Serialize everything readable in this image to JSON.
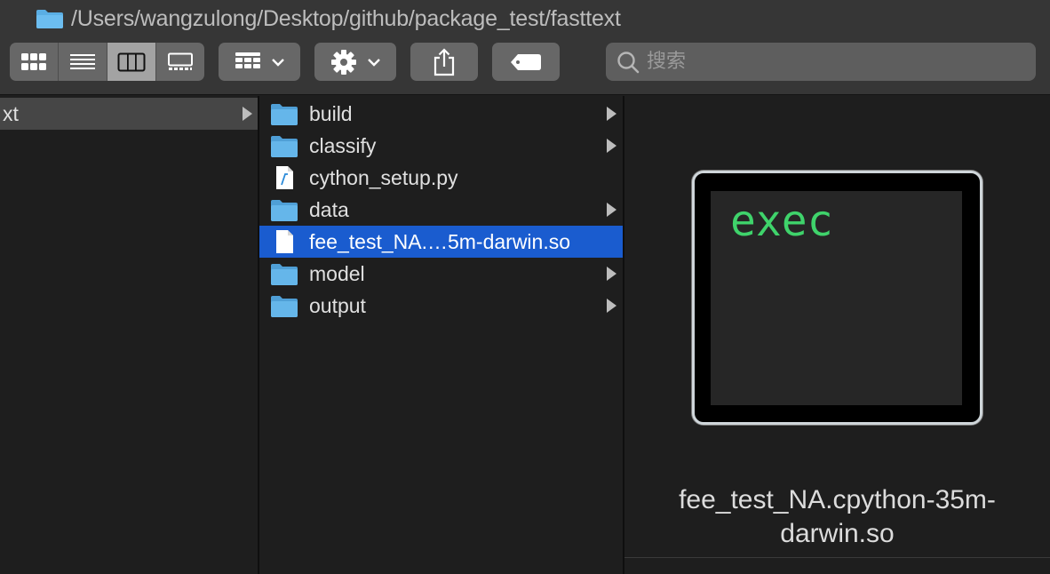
{
  "window": {
    "path": "/Users/wangzulong/Desktop/github/package_test/fasttext"
  },
  "toolbar": {
    "view_modes": [
      "icon-view",
      "list-view",
      "column-view",
      "gallery-view"
    ],
    "active_view": "column-view",
    "search_placeholder": "搜索"
  },
  "parent_column": {
    "item_label": "xt"
  },
  "files": [
    {
      "name": "build",
      "kind": "folder",
      "has_children": true
    },
    {
      "name": "classify",
      "kind": "folder",
      "has_children": true
    },
    {
      "name": "cython_setup.py",
      "kind": "python-file",
      "has_children": false
    },
    {
      "name": "data",
      "kind": "folder",
      "has_children": true
    },
    {
      "name": "fee_test_NA.…5m-darwin.so",
      "kind": "document",
      "has_children": false,
      "selected": true
    },
    {
      "name": "model",
      "kind": "folder",
      "has_children": true
    },
    {
      "name": "output",
      "kind": "folder",
      "has_children": true
    }
  ],
  "preview": {
    "icon_text": "exec",
    "name_line1": "fee_test_NA.cpython-35m-",
    "name_line2": "darwin.so"
  },
  "colors": {
    "accent_selection": "#1a5ccf",
    "folder_blue": "#5aaee4",
    "exec_green": "#3fd36b"
  }
}
